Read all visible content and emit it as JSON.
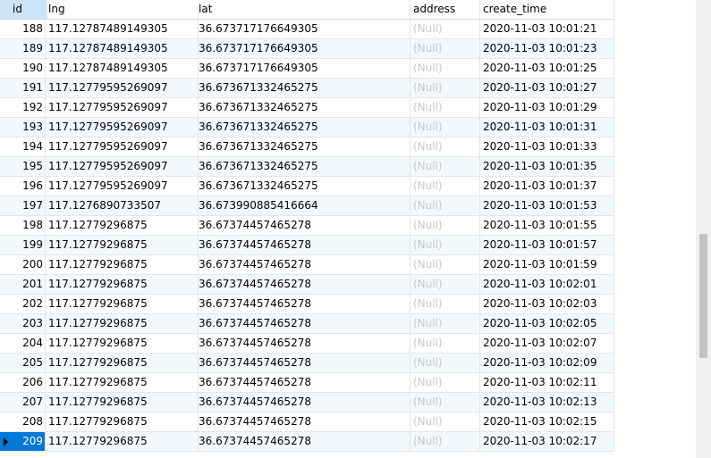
{
  "columns": [
    {
      "key": "id",
      "label": "id"
    },
    {
      "key": "lng",
      "label": "lng"
    },
    {
      "key": "lat",
      "label": "lat"
    },
    {
      "key": "address",
      "label": "address"
    },
    {
      "key": "create_time",
      "label": "create_time"
    }
  ],
  "rows": [
    {
      "id": "188",
      "lng": "117.12787489149305",
      "lat": "36.673717176649305",
      "address": "(Null)",
      "create_time": "2020-11-03 10:01:21"
    },
    {
      "id": "189",
      "lng": "117.12787489149305",
      "lat": "36.673717176649305",
      "address": "(Null)",
      "create_time": "2020-11-03 10:01:23"
    },
    {
      "id": "190",
      "lng": "117.12787489149305",
      "lat": "36.673717176649305",
      "address": "(Null)",
      "create_time": "2020-11-03 10:01:25"
    },
    {
      "id": "191",
      "lng": "117.12779595269097",
      "lat": "36.673671332465275",
      "address": "(Null)",
      "create_time": "2020-11-03 10:01:27"
    },
    {
      "id": "192",
      "lng": "117.12779595269097",
      "lat": "36.673671332465275",
      "address": "(Null)",
      "create_time": "2020-11-03 10:01:29"
    },
    {
      "id": "193",
      "lng": "117.12779595269097",
      "lat": "36.673671332465275",
      "address": "(Null)",
      "create_time": "2020-11-03 10:01:31"
    },
    {
      "id": "194",
      "lng": "117.12779595269097",
      "lat": "36.673671332465275",
      "address": "(Null)",
      "create_time": "2020-11-03 10:01:33"
    },
    {
      "id": "195",
      "lng": "117.12779595269097",
      "lat": "36.673671332465275",
      "address": "(Null)",
      "create_time": "2020-11-03 10:01:35"
    },
    {
      "id": "196",
      "lng": "117.12779595269097",
      "lat": "36.673671332465275",
      "address": "(Null)",
      "create_time": "2020-11-03 10:01:37"
    },
    {
      "id": "197",
      "lng": "117.1276890733507",
      "lat": "36.673990885416664",
      "address": "(Null)",
      "create_time": "2020-11-03 10:01:53"
    },
    {
      "id": "198",
      "lng": "117.12779296875",
      "lat": "36.67374457465278",
      "address": "(Null)",
      "create_time": "2020-11-03 10:01:55"
    },
    {
      "id": "199",
      "lng": "117.12779296875",
      "lat": "36.67374457465278",
      "address": "(Null)",
      "create_time": "2020-11-03 10:01:57"
    },
    {
      "id": "200",
      "lng": "117.12779296875",
      "lat": "36.67374457465278",
      "address": "(Null)",
      "create_time": "2020-11-03 10:01:59"
    },
    {
      "id": "201",
      "lng": "117.12779296875",
      "lat": "36.67374457465278",
      "address": "(Null)",
      "create_time": "2020-11-03 10:02:01"
    },
    {
      "id": "202",
      "lng": "117.12779296875",
      "lat": "36.67374457465278",
      "address": "(Null)",
      "create_time": "2020-11-03 10:02:03"
    },
    {
      "id": "203",
      "lng": "117.12779296875",
      "lat": "36.67374457465278",
      "address": "(Null)",
      "create_time": "2020-11-03 10:02:05"
    },
    {
      "id": "204",
      "lng": "117.12779296875",
      "lat": "36.67374457465278",
      "address": "(Null)",
      "create_time": "2020-11-03 10:02:07"
    },
    {
      "id": "205",
      "lng": "117.12779296875",
      "lat": "36.67374457465278",
      "address": "(Null)",
      "create_time": "2020-11-03 10:02:09"
    },
    {
      "id": "206",
      "lng": "117.12779296875",
      "lat": "36.67374457465278",
      "address": "(Null)",
      "create_time": "2020-11-03 10:02:11"
    },
    {
      "id": "207",
      "lng": "117.12779296875",
      "lat": "36.67374457465278",
      "address": "(Null)",
      "create_time": "2020-11-03 10:02:13"
    },
    {
      "id": "208",
      "lng": "117.12779296875",
      "lat": "36.67374457465278",
      "address": "(Null)",
      "create_time": "2020-11-03 10:02:15"
    },
    {
      "id": "209",
      "lng": "117.12779296875",
      "lat": "36.67374457465278",
      "address": "(Null)",
      "create_time": "2020-11-03 10:02:17"
    }
  ],
  "selected_row_id": "209",
  "scroll": {
    "position": 0.7,
    "visible_fraction": 0.27
  },
  "colors": {
    "accent": "#0078d7",
    "header_selected": "#cce4f7",
    "null_text": "#c8c8c8",
    "alt_row": "#f3f8fd"
  },
  "icons": {
    "current_row_marker": "triangle-right-icon"
  }
}
